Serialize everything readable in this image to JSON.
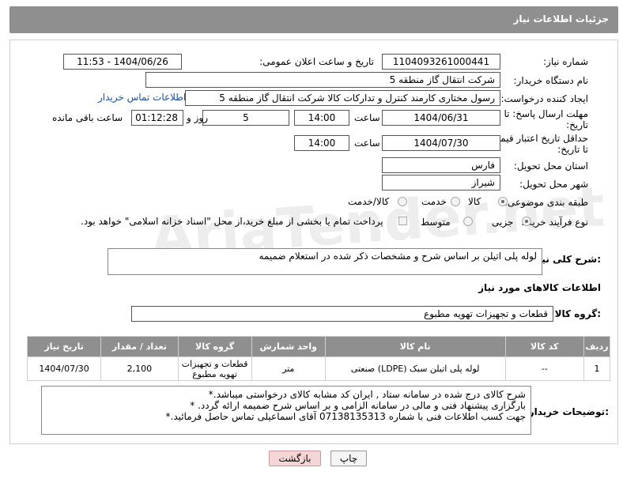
{
  "header": {
    "title": "جزئیات اطلاعات نیاز"
  },
  "form": {
    "need_number_label": "شماره نیاز:",
    "need_number": "1104093261000441",
    "announce_label": "تاریخ و ساعت اعلان عمومی:",
    "announce_value": "1404/06/26 - 11:53",
    "buyer_org_label": "نام دستگاه خریدار:",
    "buyer_org": "شرکت انتقال گاز منطقه 5",
    "creator_label": "ایجاد کننده درخواست:",
    "creator": "رسول  مختاری کارمند کنترل و تدارکات کالا شرکت انتقال گاز منطقه 5",
    "contact_link": "اطلاعات تماس خریدار",
    "deadline_label_1": "مهلت ارسال پاسخ: تا",
    "deadline_label_2": "تاریخ:",
    "deadline_date": "1404/06/31",
    "time_label": "ساعت",
    "deadline_time": "14:00",
    "days_value": "5",
    "days_label": "روز و",
    "remaining_time": "01:12:28",
    "remaining_label": "ساعت باقی مانده",
    "price_label_1": "حداقل تاریخ اعتبار قیمت:",
    "price_label_2": "تا تاریخ:",
    "price_date": "1404/07/30",
    "price_time_label": "ساعت",
    "price_time": "14:00",
    "province_label": "استان محل تحویل:",
    "province": "فارس",
    "city_label": "شهر محل تحویل:",
    "city": "شیراز",
    "category_label": "طبقه بندی موضوعی:",
    "category_options": [
      "کالا",
      "خدمت",
      "کالا/خدمت"
    ],
    "process_label": "نوع فرآیند خرید :",
    "process_options": [
      "جزیی",
      "متوسط"
    ],
    "payment_note": "پرداخت تمام یا بخشی از مبلغ خرید،از محل \"اسناد خزانه اسلامی\" خواهد بود.",
    "summary_label": "شرح کلی نیاز:",
    "summary": "لوله پلی اتیلن بر اساس شرح و مشخصات ذکر شده در استعلام ضمیمه",
    "goods_info_title": "اطلاعات کالاهای مورد نیاز",
    "goods_group_label": "گروه کالا:",
    "goods_group": "قطعات و تجهیزات تهویه مطبوع"
  },
  "table": {
    "headers": [
      "ردیف",
      "کد کالا",
      "نام کالا",
      "واحد شمارش",
      "گروه کالا",
      "تعداد / مقدار",
      "تاریخ نیاز"
    ],
    "rows": [
      [
        "1",
        "--",
        "لوله پلی اتیلن سبک (LDPE) صنعتی",
        "متر",
        "قطعات و تجهیزات تهویه مطبوع",
        "2,100",
        "1404/07/30"
      ]
    ]
  },
  "buyer_notes": {
    "label": "توضیحات خریدار:",
    "text": "شرح کالای درج شده در سامانه ستاد , ایران کد مشابه کالای درخواستی میباشد.*\nبارگزاری پیشنهاد فنی و مالی در سامانه الزامی و بر اساس شرح ضمیمه ارائه گردد. *\nجهت کسب اطلاعات فنی با شماره 07138135313 آقای اسماعیلی تماس حاصل فرمائید.*"
  },
  "buttons": {
    "print": "چاپ",
    "back": "بازگشت"
  },
  "colors": {
    "header_bg": "#8f8f8f",
    "link": "#1a4fa0",
    "back_btn_bg": "#f5d6d6"
  }
}
